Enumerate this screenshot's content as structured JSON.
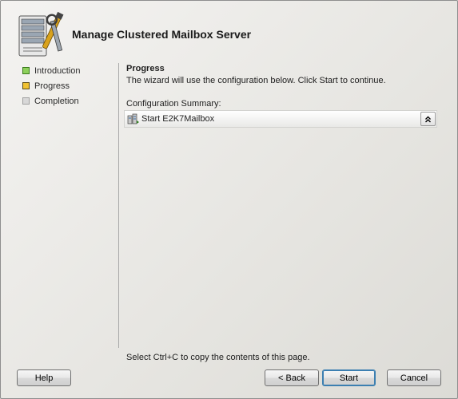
{
  "wizard": {
    "title": "Manage Clustered Mailbox Server"
  },
  "steps": [
    {
      "label": "Introduction",
      "state": "done"
    },
    {
      "label": "Progress",
      "state": "current"
    },
    {
      "label": "Completion",
      "state": "pending"
    }
  ],
  "progress": {
    "heading": "Progress",
    "description": "The wizard will use the configuration below.  Click Start to continue.",
    "summary_label": "Configuration Summary:",
    "summary_items": [
      {
        "text": "Start E2K7Mailbox",
        "icon": "exchange-server-icon"
      }
    ]
  },
  "footer": {
    "copy_hint": "Select Ctrl+C to copy the contents of this page.",
    "help_label": "Help",
    "back_label": "< Back",
    "start_label": "Start",
    "cancel_label": "Cancel"
  },
  "colors": {
    "done": "#8dd05b",
    "current": "#f1c232",
    "pending": "#d8d8d8"
  }
}
